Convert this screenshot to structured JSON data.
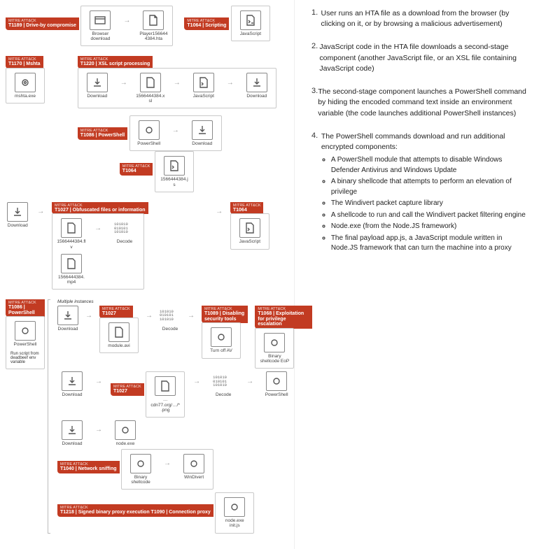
{
  "attacks": {
    "t1189": {
      "prefix": "MITRE ATT&CK",
      "label": "T1189 | Drive-by compromise"
    },
    "t1064": {
      "prefix": "MITRE ATT&CK",
      "label": "T1064 | Scripting"
    },
    "t1170": {
      "prefix": "MITRE ATT&CK",
      "label": "T1170 | Mshta"
    },
    "t1220": {
      "prefix": "MITRE ATT&CK",
      "label": "T1220 | XSL script processing"
    },
    "t1086": {
      "prefix": "MITRE ATT&CK",
      "label": "T1086 | PowerShell"
    },
    "t1064b": {
      "prefix": "MITRE ATT&CK",
      "label": "T1064"
    },
    "t1027": {
      "prefix": "MITRE ATT&CK",
      "label": "T1027 | Obfuscated files or information"
    },
    "t1027b": {
      "prefix": "MITRE ATT&CK",
      "label": "T1027"
    },
    "t1089": {
      "prefix": "MITRE ATT&CK",
      "label": "T1089 | Disabling security tools"
    },
    "t1068": {
      "prefix": "MITRE ATT&CK",
      "label": "T1068 | Exploitation for privilege escalation"
    },
    "t1040": {
      "prefix": "MITRE ATT&CK",
      "label": "T1040 | Network sniffing"
    },
    "t1218": {
      "prefix": "MITRE ATT&CK",
      "label": "T1218 | Signed binary proxy execution T1090 | Connection proxy"
    }
  },
  "nodes": {
    "browser": "Browser download",
    "hta": "Player1566444384.hta",
    "js": "JavaScript",
    "mshta": "mshta.exe",
    "download": "Download",
    "xsl": "1566444384.xsl",
    "powershell": "PowerShell",
    "jsfile": "1566444384.js",
    "flv": "1566444384.flv",
    "mp4": "1566444384.mp4",
    "decode": "Decode",
    "multi": "Multiple instances",
    "runscript": "Run script from deadbeef env variable",
    "moduleavi": "module.avi",
    "turnoffav": "Turn off AV",
    "binshell": "Binary shellcode EoP",
    "cdn": "…cdn77.org/…/*.png",
    "nodeexe": "node.exe",
    "windivert": "WinDivert",
    "binshell2": "Binary shellcode",
    "nodeinit": "node.exe init.js",
    "decbits": "101010\n010101\n101010"
  },
  "desc": {
    "s1": {
      "n": "1.",
      "t": "User runs an HTA file as a download from the browser   (by clicking on it, or by browsing a malicious advertisement)"
    },
    "s2": {
      "n": "2.",
      "t": "JavaScript code in the HTA file downloads a second-stage component (another JavaScript file, or an XSL file containing JavaScript code)"
    },
    "s3": {
      "n": "3.",
      "t": "The second-stage component launches a PowerShell command by hiding the encoded command text inside an environment variable (the code launches additional PowerShell instances)"
    },
    "s4": {
      "n": "4.",
      "h": "The PowerShell commands download and run additional encrypted components:",
      "items": [
        "A PowerShell module that attempts to disable Windows Defender Antivirus   and Windows Update",
        "A binary shellcode that attempts to perform an elevation of privilege",
        "The Windivert packet capture library",
        "A shellcode to run and call the Windivert packet filtering engine",
        "Node.exe (from the Node.JS framework)",
        "The final payload app.js, a JavaScript module written in Node.JS framework that can turn the machine into a proxy"
      ]
    }
  }
}
